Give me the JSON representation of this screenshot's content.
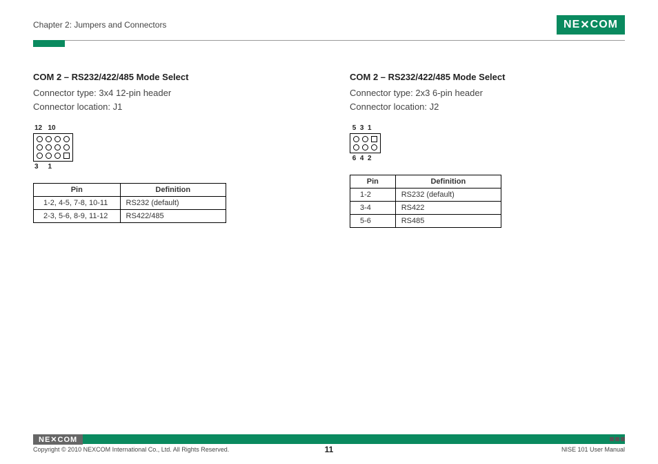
{
  "header": {
    "chapter": "Chapter 2: Jumpers and Connectors",
    "logo_text": "NE COM"
  },
  "left": {
    "title": "COM 2 – RS232/422/485 Mode Select",
    "type": "Connector type: 3x4 12-pin header",
    "loc": "Connector location: J1",
    "labels": {
      "top": "12   10",
      "bot": "3     1"
    },
    "table": {
      "h1": "Pin",
      "h2": "Definition",
      "rows": [
        {
          "pin": "1-2, 4-5, 7-8, 10-11",
          "def": "RS232 (default)"
        },
        {
          "pin": "2-3, 5-6, 8-9, 11-12",
          "def": "RS422/485"
        }
      ]
    }
  },
  "right": {
    "title": "COM 2 – RS232/422/485 Mode Select",
    "type": "Connector type: 2x3 6-pin header",
    "loc": "Connector location: J2",
    "labels": {
      "top": " 5  3  1",
      "bot": " 6  4  2"
    },
    "table": {
      "h1": "Pin",
      "h2": "Definition",
      "rows": [
        {
          "pin": "1-2",
          "def": "RS232 (default)"
        },
        {
          "pin": "3-4",
          "def": "RS422"
        },
        {
          "pin": "5-6",
          "def": "RS485"
        }
      ]
    }
  },
  "footer": {
    "logo": "NE COM",
    "copyright": "Copyright © 2010 NEXCOM International Co., Ltd. All Rights Reserved.",
    "page": "11",
    "doc": "NISE 101 User Manual"
  }
}
